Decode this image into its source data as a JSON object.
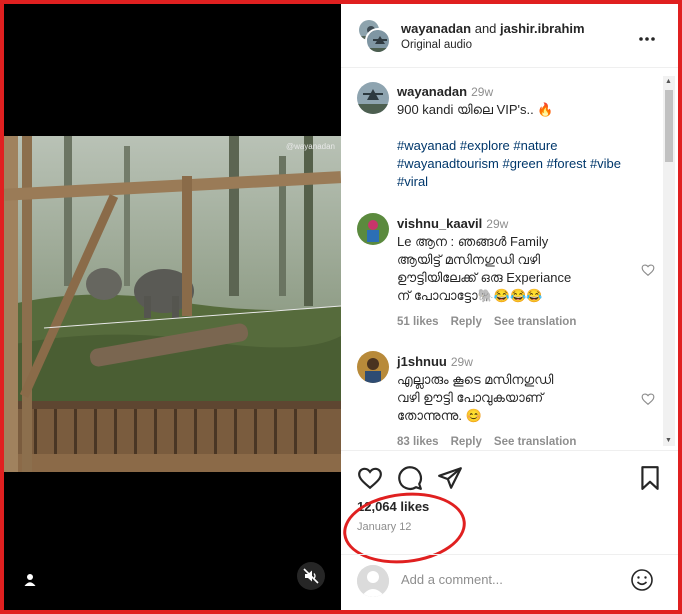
{
  "media": {
    "watermark": "@wayanadan",
    "icons": {
      "user_tag": "person-icon",
      "mute": "muted-speaker-icon"
    }
  },
  "header": {
    "user1": "wayanadan",
    "joiner": "and",
    "user2": "jashir.ibrahim",
    "subtitle": "Original audio",
    "more_icon": "more-dots-icon"
  },
  "caption": {
    "username": "wayanadan",
    "time": "29w",
    "text": "900 kandi യിലെ VIP's.. 🔥",
    "hashtags_line1": "#wayanad #explore #nature",
    "hashtags_line2": "#wayanadtourism #green #forest #vibe",
    "hashtags_line3": "#viral"
  },
  "comments": [
    {
      "username": "vishnu_kaavil",
      "time": "29w",
      "lines": [
        "Le ആന : ഞങ്ങൾ Family",
        "ആയിട്ട് മസിനഗുഡി വഴി",
        "ഊട്ടിയിലേക്ക് ഒരു Experiance",
        "ന് പോവാട്ടോ🐘😂😂😂"
      ],
      "likes": "51 likes",
      "reply": "Reply",
      "translate": "See translation"
    },
    {
      "username": "j1shnuu",
      "time": "29w",
      "lines": [
        "എല്ലാരും കൂടെ മസിനഗുഡി",
        "വഴി ഊട്ടി പോവുകയാണ്",
        "തോന്നുന്നു. 😊"
      ],
      "likes": "83 likes",
      "reply": "Reply",
      "translate": "See translation"
    }
  ],
  "actions": {
    "likes": "12,064 likes",
    "date": "January 12",
    "icons": [
      "heart-icon",
      "comment-icon",
      "share-icon",
      "bookmark-icon"
    ]
  },
  "add_comment": {
    "placeholder": "Add a comment...",
    "emoji_icon": "emoji-icon"
  },
  "colors": {
    "annotation_red": "#e02020",
    "link_blue": "#00376b",
    "muted_gray": "#8e8e8e"
  }
}
